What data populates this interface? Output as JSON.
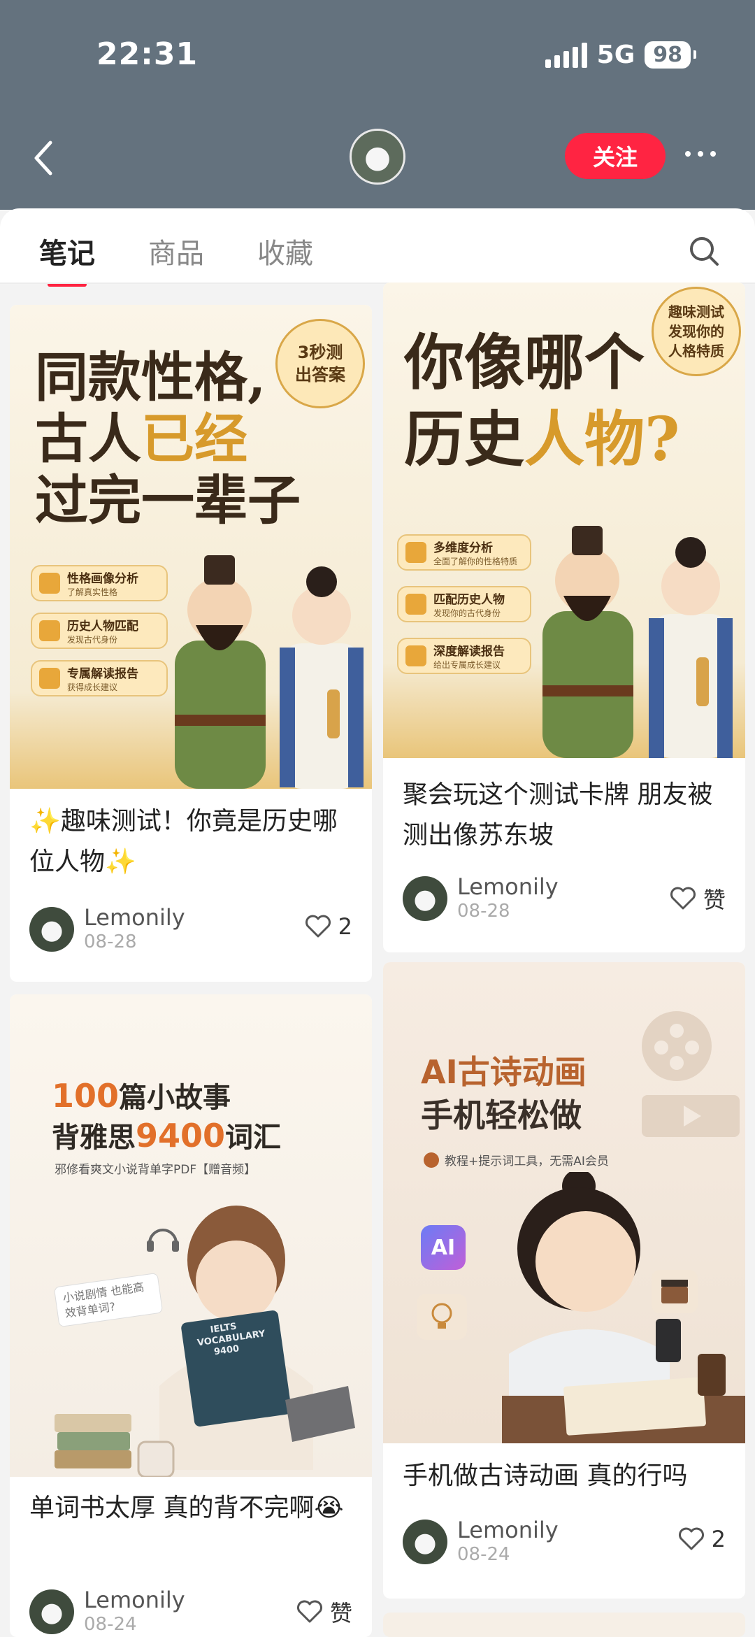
{
  "status": {
    "time": "22:31",
    "network": "5G",
    "battery": "98"
  },
  "header": {
    "follow_label": "关注"
  },
  "tabs": [
    {
      "label": "笔记"
    },
    {
      "label": "商品"
    },
    {
      "label": "收藏"
    }
  ],
  "cards": [
    {
      "cover": {
        "line1": "同款性格,",
        "line2a": "古人",
        "line2b": "已经",
        "line3": "过完一辈子",
        "badge": "3秒测出答案",
        "items": [
          {
            "t1": "性格画像分析",
            "t2": "了解真实性格"
          },
          {
            "t1": "历史人物匹配",
            "t2": "发现古代身份"
          },
          {
            "t1": "专属解读报告",
            "t2": "获得成长建议"
          }
        ]
      },
      "title": "✨趣味测试！你竟是历史哪位人物✨",
      "author": "Lemonily",
      "date": "08-28",
      "likes": "2"
    },
    {
      "cover": {
        "line1": "你像哪个",
        "line2a": "历史",
        "line2b": "人物?",
        "badge": "趣味测试发现你的人格特质",
        "items": [
          {
            "t1": "多维度分析",
            "t2": "全面了解你的性格特质"
          },
          {
            "t1": "匹配历史人物",
            "t2": "发现你的古代身份"
          },
          {
            "t1": "深度解读报告",
            "t2": "给出专属成长建议"
          }
        ]
      },
      "title": "聚会玩这个测试卡牌 朋友被测出像苏东坡",
      "author": "Lemonily",
      "date": "08-28",
      "likes": "赞"
    },
    {
      "cover": {
        "line1a": "100",
        "line1b": "篇小故事",
        "line2a": "背雅思",
        "line2b": "9400",
        "line2c": "词汇",
        "sub": "邪修看爽文小说背单字PDF【赠音频】",
        "note": "小说剧情 也能高效背单词?",
        "book": "IELTS VOCABULARY 9400"
      },
      "title": "单词书太厚 真的背不完啊😭",
      "author": "Lemonily",
      "date": "08-24",
      "likes": "赞"
    },
    {
      "cover": {
        "line1": "AI古诗动画",
        "line2": "手机轻松做",
        "sub": "教程+提示词工具，无需AI会员",
        "ai_badge": "AI"
      },
      "title": "手机做古诗动画 真的行吗",
      "author": "Lemonily",
      "date": "08-24",
      "likes": "2"
    }
  ],
  "colors": {
    "accent": "#ff2442",
    "header_bg": "#64727e",
    "gold": "#d79a2b"
  }
}
